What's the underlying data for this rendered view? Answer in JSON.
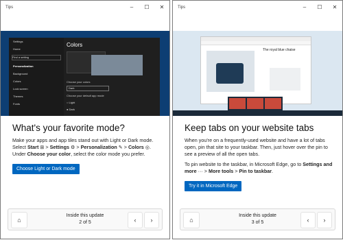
{
  "left": {
    "title": "Tips",
    "settings_window": {
      "title": "Settings",
      "home": "Home",
      "search_placeholder": "Find a setting",
      "section": "Personalization",
      "nav": [
        "Background",
        "Colors",
        "Lock screen",
        "Themes",
        "Fonts"
      ],
      "pane_title": "Colors",
      "choose_colors_label": "Choose your colors",
      "choose_colors_value": "Dark",
      "app_mode_label": "Choose your default app mode",
      "radio_light": "Light",
      "radio_dark": "Dark"
    },
    "heading": "What's your favorite mode?",
    "p1_a": "Make your apps and app tiles stand out with Light or Dark mode. Select ",
    "p1_start": "Start",
    "p1_sep1": " > ",
    "p1_settings": "Settings",
    "p1_sep2": " > ",
    "p1_personalization": "Personalization",
    "p1_sep3": " > ",
    "p1_colors": "Colors",
    "p1_b": ". Under ",
    "p1_choose": "Choose your color",
    "p1_c": ", select the color mode you prefer.",
    "button": "Choose Light or Dark mode",
    "footer_label": "Inside this update",
    "footer_page": "2 of 5"
  },
  "right": {
    "title": "Tips",
    "browser": {
      "product_title": "The royal blue chaise"
    },
    "heading": "Keep tabs on your website tabs",
    "p1": "When you're on a frequently-used website and have a lot of tabs open, pin that site to your taskbar. Then, just hover over the pin to see a preview of all the open tabs.",
    "p2_a": "To pin website to the taskbar, in Microsoft Edge, go to ",
    "p2_settings": "Settings and more",
    "p2_b": " ··· > ",
    "p2_more": "More tools",
    "p2_c": " > ",
    "p2_pin": "Pin to taskbar",
    "p2_d": ".",
    "button": "Try it in Microsoft Edge",
    "footer_label": "Inside this update",
    "footer_page": "3 of 5"
  },
  "icons": {
    "minimize": "minimize-icon",
    "maximize": "maximize-icon",
    "close": "close-icon",
    "home": "home-icon",
    "prev": "chevron-left-icon",
    "next": "chevron-right-icon",
    "windows": "windows-logo-icon",
    "gear": "gear-icon",
    "brush": "brush-icon",
    "palette": "palette-icon"
  },
  "colors": {
    "accent": "#0067c0"
  }
}
